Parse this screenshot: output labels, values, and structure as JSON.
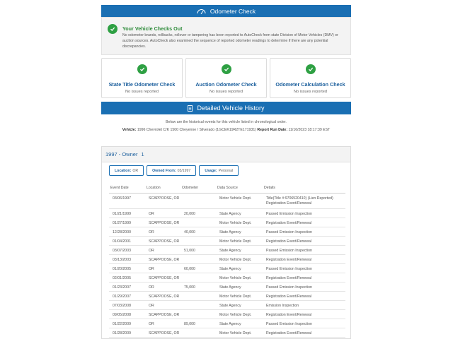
{
  "odometer_check": {
    "header": "Odometer Check",
    "summary_title": "Your Vehicle Checks Out",
    "summary_desc": "No odometer brands, rollbacks, rollover or tampering has been reported to AutoCheck from state Division of Motor Vehicles (DMV) or auction sources. AutoCheck also examined the sequence of reported odometer readings to determine if there are any potential discrepancies.",
    "cards": [
      {
        "title": "State Title Odometer Check",
        "status": "No issues reported"
      },
      {
        "title": "Auction Odometer Check",
        "status": "No issues reported"
      },
      {
        "title": "Odometer Calculation Check",
        "status": "No issues reported"
      }
    ]
  },
  "history": {
    "header": "Detailed Vehicle History",
    "intro": "Below are the historical events for this vehicle listed in chronological order.",
    "vehicle_label": "Vehicle:",
    "vehicle_value": "1996 Chevrolet C/K 1500 Cheyenne / Silverado (1GCEK19R2TE171931)",
    "run_date_label": "Report Run Date:",
    "run_date_value": "11/16/2023 18:17:39 EST"
  },
  "owner": {
    "title": "1997 - Owner",
    "number": "1",
    "location_label": "Location:",
    "location_value": "OR",
    "owned_from_label": "Owned From:",
    "owned_from_value": "03/1997",
    "usage_label": "Usage:",
    "usage_value": "Personal"
  },
  "table": {
    "headers": [
      "Event Date",
      "Location",
      "Odometer",
      "Data Source",
      "Details"
    ],
    "rows": [
      [
        "03/06/1997",
        "SCAPPOOSE, OR",
        "",
        "Motor Vehicle Dept.",
        "Title(Title #:9706520410) (Lien Reported)\nRegistration Event/Renewal"
      ],
      [
        "01/21/1999",
        "OR",
        "20,000",
        "State Agency",
        "Passed Emission Inspection"
      ],
      [
        "01/27/1999",
        "SCAPPOOSE, OR",
        "",
        "Motor Vehicle Dept.",
        "Registration Event/Renewal"
      ],
      [
        "12/28/2000",
        "OR",
        "40,000",
        "State Agency",
        "Passed Emission Inspection"
      ],
      [
        "01/04/2001",
        "SCAPPOOSE, OR",
        "",
        "Motor Vehicle Dept.",
        "Registration Event/Renewal"
      ],
      [
        "03/07/2003",
        "OR",
        "51,000",
        "State Agency",
        "Passed Emission Inspection"
      ],
      [
        "03/13/2003",
        "SCAPPOOSE, OR",
        "",
        "Motor Vehicle Dept.",
        "Registration Event/Renewal"
      ],
      [
        "01/20/2005",
        "OR",
        "60,000",
        "State Agency",
        "Passed Emission Inspection"
      ],
      [
        "02/01/2005",
        "SCAPPOOSE, OR",
        "",
        "Motor Vehicle Dept.",
        "Registration Event/Renewal"
      ],
      [
        "01/23/2007",
        "OR",
        "75,000",
        "State Agency",
        "Passed Emission Inspection"
      ],
      [
        "01/29/2007",
        "SCAPPOOSE, OR",
        "",
        "Motor Vehicle Dept.",
        "Registration Event/Renewal"
      ],
      [
        "07/03/2008",
        "OR",
        "",
        "State Agency",
        "Emission Inspection"
      ],
      [
        "09/05/2008",
        "SCAPPOOSE, OR",
        "",
        "Motor Vehicle Dept.",
        "Registration Event/Renewal"
      ],
      [
        "01/22/2009",
        "OR",
        "89,000",
        "State Agency",
        "Passed Emission Inspection"
      ],
      [
        "01/28/2009",
        "SCAPPOOSE, OR",
        "",
        "Motor Vehicle Dept.",
        "Registration Event/Renewal"
      ]
    ]
  },
  "colors": {
    "header_blue": "#1a6fb3",
    "check_green": "#2ea043",
    "link_blue": "#1a5e9c"
  },
  "icons": [
    "odometer-icon",
    "check-icon",
    "document-icon"
  ]
}
